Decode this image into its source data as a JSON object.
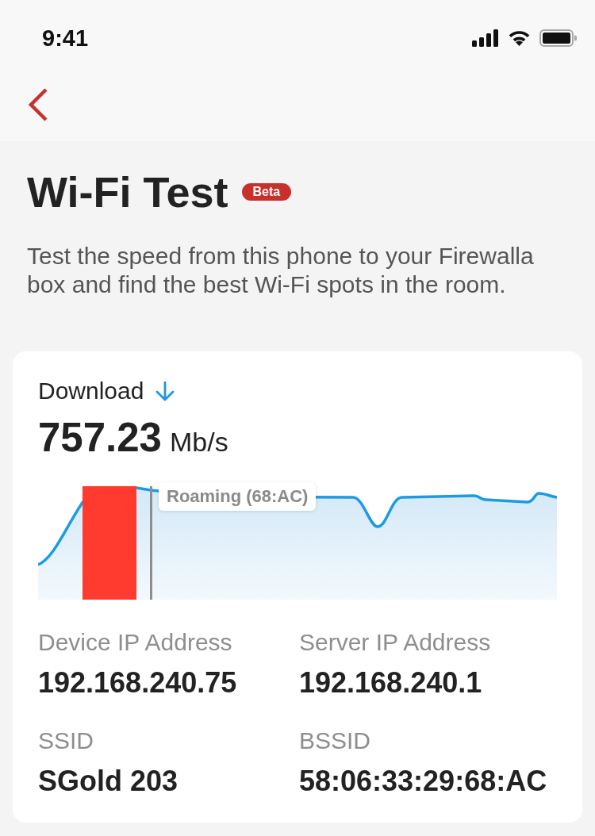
{
  "status_bar": {
    "time": "9:41"
  },
  "header": {
    "title": "Wi-Fi Test",
    "badge": "Beta",
    "description": "Test the speed from this phone to your Firewalla box and find the best Wi-Fi spots in the room."
  },
  "result_card": {
    "label": "Download",
    "value": "757.23",
    "unit": "Mb/s",
    "chart": {
      "tooltip": "Roaming (68:AC)"
    },
    "details": [
      {
        "label": "Device IP Address",
        "value": "192.168.240.75"
      },
      {
        "label": "Server IP Address",
        "value": "192.168.240.1"
      },
      {
        "label": "SSID",
        "value": "SGold 203"
      },
      {
        "label": "BSSID",
        "value": "58:06:33:29:68:AC"
      }
    ]
  }
}
